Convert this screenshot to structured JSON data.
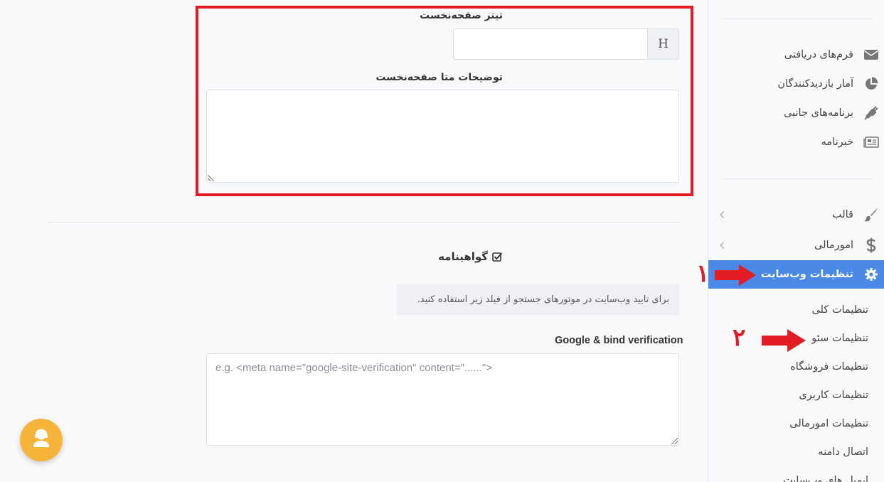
{
  "sidebar": {
    "items": [
      {
        "label": "فرم‌های دریافتی",
        "icon": "envelope-icon"
      },
      {
        "label": "آمار بازدیدکنندگان",
        "icon": "pie-chart-icon"
      },
      {
        "label": "برنامه‌های جانبی",
        "icon": "plug-icon"
      },
      {
        "label": "خبرنامه",
        "icon": "newspaper-icon"
      }
    ],
    "menus": [
      {
        "label": "قالب",
        "icon": "paint-brush-icon"
      },
      {
        "label": "امورمالی",
        "icon": "dollar-icon"
      },
      {
        "label": "تنظیمات وب‌سایت",
        "icon": "gear-icon"
      }
    ],
    "submenu": [
      "تنظیمات کلی",
      "تنظیمات سئو",
      "تنظیمات فروشگاه",
      "تنظیمات کاربری",
      "تنظیمات امورمالی",
      "اتصال دامنه",
      "ایمیل های وب‌سایت"
    ],
    "active_color": "#4a8ae6"
  },
  "annotations": {
    "step1": "۱",
    "step2": "۲",
    "color": "#e31b23"
  },
  "main": {
    "home_title_label": "تیتر صفحه‌نخست",
    "home_title_value": "",
    "home_title_addon": "H",
    "meta_desc_label": "توضیحات متا صفحه‌نخست",
    "meta_desc_value": "",
    "certificate_label": "گواهینامه",
    "certificate_checked": true,
    "info_text": "برای تایید وب‌سایت در موتورهای جستجو از فیلد زیر استفاده کنید.",
    "verification_label": "Google & bind verification",
    "verification_placeholder": "e.g. <meta name=\"google-site-verification\" content=\"......\">"
  },
  "support": {
    "icon": "support-agent-icon",
    "color": "#f7b43a"
  }
}
